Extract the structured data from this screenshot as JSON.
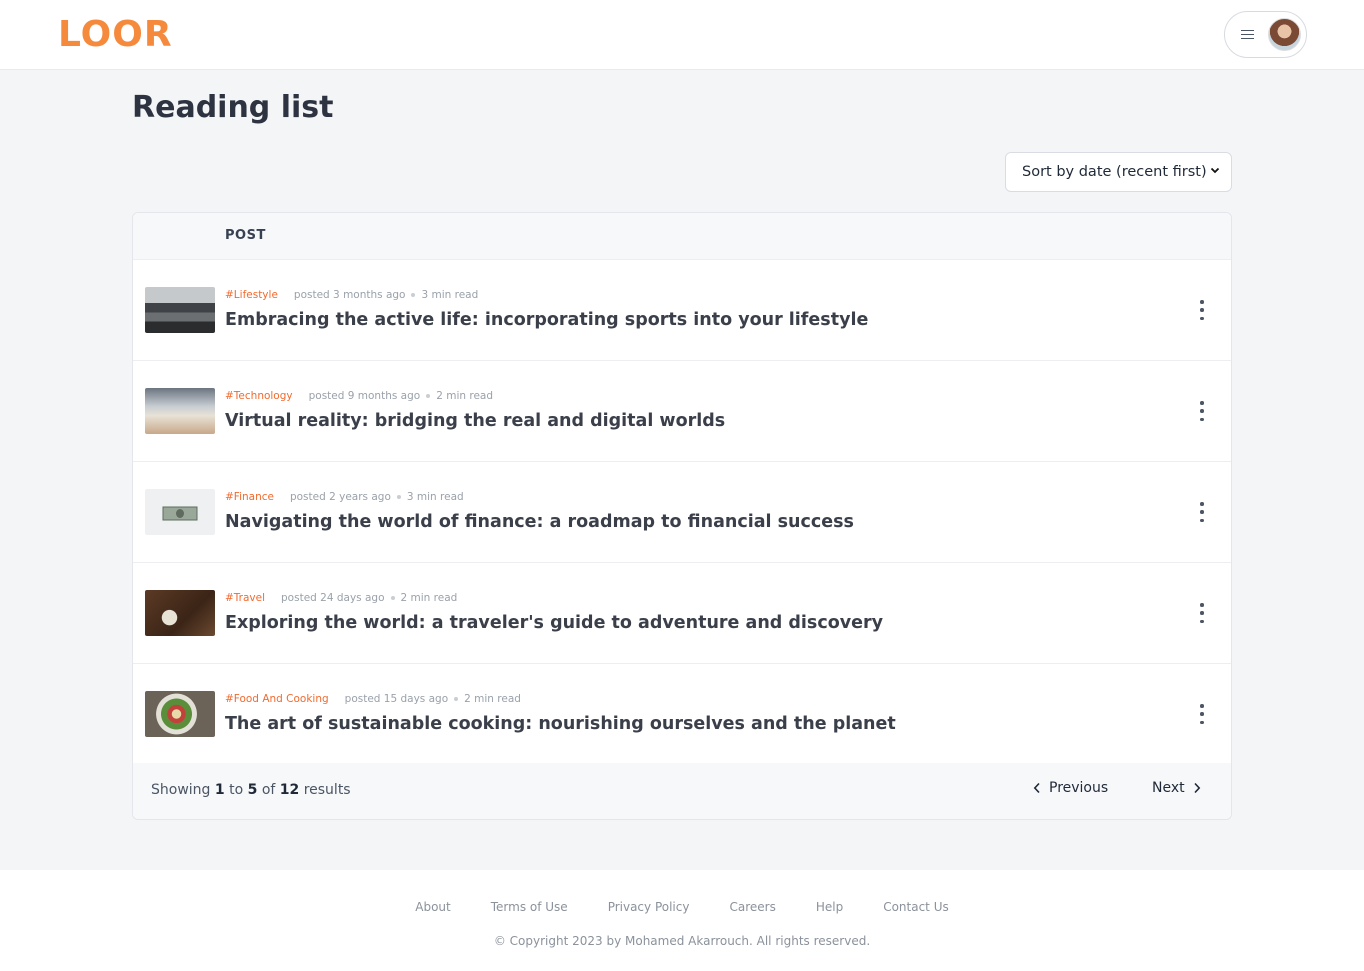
{
  "header": {
    "logo": "LOOR",
    "menu_icon": "hamburger-icon",
    "avatar": "user-avatar"
  },
  "page": {
    "title": "Reading list",
    "sort_value": "Sort by date (recent first)"
  },
  "table": {
    "header": "POST",
    "rows": [
      {
        "tag": "#Lifestyle",
        "posted": "posted 3 months ago",
        "read": "3 min read",
        "title": "Embracing the active life: incorporating sports into your lifestyle"
      },
      {
        "tag": "#Technology",
        "posted": "posted 9 months ago",
        "read": "2 min read",
        "title": "Virtual reality: bridging the real and digital worlds"
      },
      {
        "tag": "#Finance",
        "posted": "posted 2 years ago",
        "read": "3 min read",
        "title": "Navigating the world of finance: a roadmap to financial success"
      },
      {
        "tag": "#Travel",
        "posted": "posted 24 days ago",
        "read": "2 min read",
        "title": "Exploring the world: a traveler's guide to adventure and discovery"
      },
      {
        "tag": "#Food And Cooking",
        "posted": "posted 15 days ago",
        "read": "2 min read",
        "title": "The art of sustainable cooking: nourishing ourselves and the planet"
      }
    ]
  },
  "pagination": {
    "showing_prefix": "Showing",
    "from": "1",
    "to_word": "to",
    "to": "5",
    "of_word": "of",
    "total": "12",
    "results_word": "results",
    "previous": "Previous",
    "next": "Next"
  },
  "footer": {
    "links": [
      "About",
      "Terms of Use",
      "Privacy Policy",
      "Careers",
      "Help",
      "Contact Us"
    ],
    "copyright": "© Copyright 2023 by Mohamed Akarrouch. All rights reserved."
  },
  "colors": {
    "brand": "#f58a3d",
    "tag": "#f26a2e"
  }
}
